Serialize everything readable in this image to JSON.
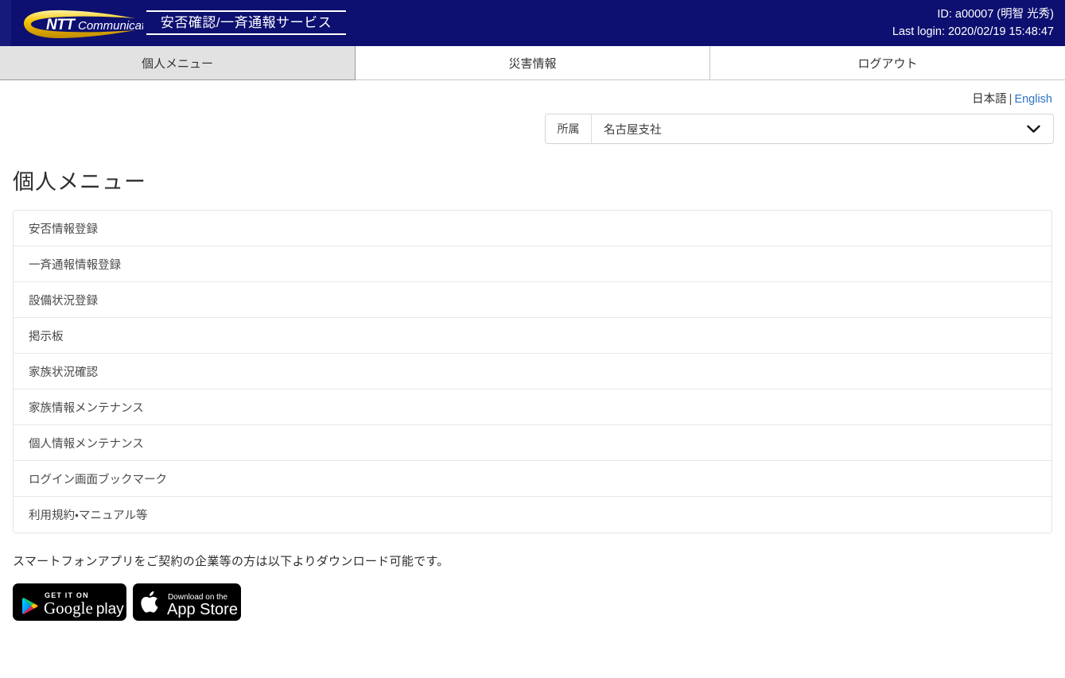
{
  "header": {
    "logo_alt": "NTT Communications",
    "logo_primary": "NTT",
    "logo_secondary": "Communications",
    "service_title": "安否確認/一斉通報サービス",
    "user_id_line": "ID: a00007 (明智 光秀)",
    "last_login_line": "Last login: 2020/02/19 15:48:47",
    "bg_color": "#0d1070",
    "accent_gold": "#f0b400"
  },
  "tabs": [
    {
      "label": "個人メニュー",
      "active": true
    },
    {
      "label": "災害情報",
      "active": false
    },
    {
      "label": "ログアウト",
      "active": false
    }
  ],
  "language": {
    "japanese": "日本語",
    "separator": "|",
    "english": "English",
    "link_color": "#2a72c4"
  },
  "affiliation": {
    "label": "所属",
    "selected": "名古屋支社",
    "icon": "chevron-down-icon"
  },
  "main": {
    "page_title": "個人メニュー",
    "menu_items": [
      {
        "label": "安否情報登録"
      },
      {
        "label": "一斉通報情報登録"
      },
      {
        "label": "設備状況登録"
      },
      {
        "label": "掲示板"
      },
      {
        "label": "家族状況確認"
      },
      {
        "label": "家族情報メンテナンス"
      },
      {
        "label": "個人情報メンテナンス"
      },
      {
        "label": "ログイン画面ブックマーク"
      },
      {
        "label": "利用規約・マニュアル等"
      }
    ],
    "app_note": "スマートフォンアプリをご契約の企業等の方は以下よりダウンロード可能です。"
  },
  "badges": {
    "google_play": {
      "icon": "google-play-icon",
      "small_text": "GET IT ON",
      "big_text_1": "Google",
      "big_text_2": "play"
    },
    "app_store": {
      "icon": "apple-logo-icon",
      "small_text": "Download on the",
      "big_text": "App Store"
    }
  }
}
